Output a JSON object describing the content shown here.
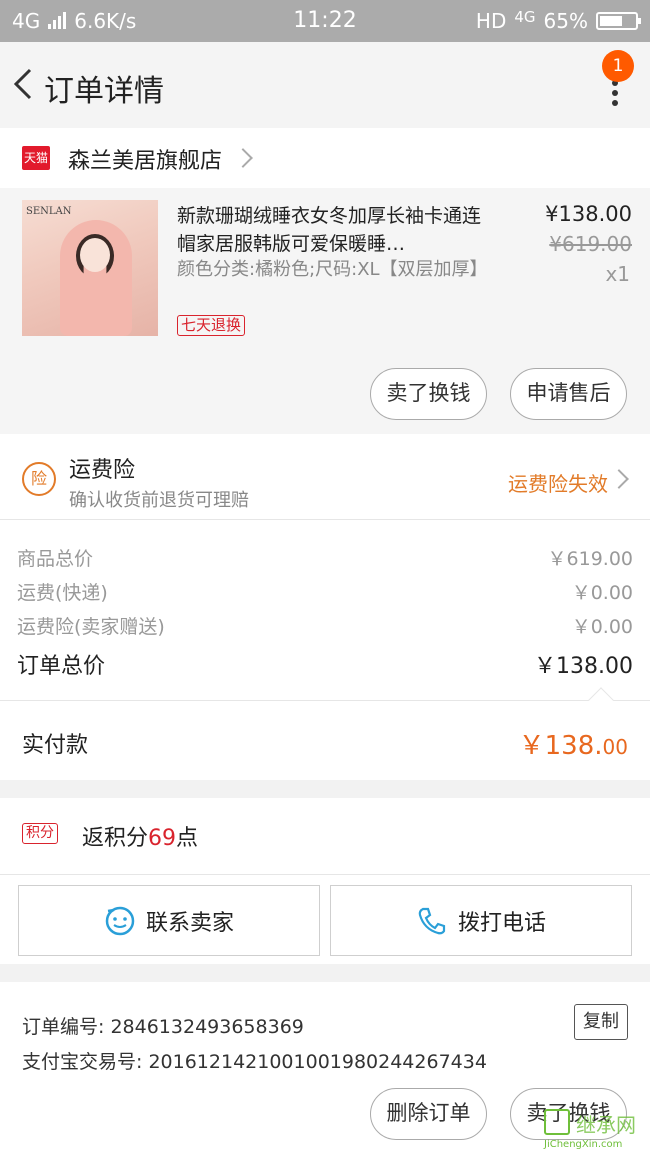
{
  "status_bar": {
    "network": "4G",
    "speed": "6.6K/s",
    "time": "11:22",
    "hd": "HD",
    "network_right": "4G",
    "battery": "65%",
    "battery_level": 0.65
  },
  "nav": {
    "title": "订单详情",
    "badge_count": "1"
  },
  "shop": {
    "icon_label": "天猫",
    "name": "森兰美居旗舰店"
  },
  "product": {
    "image_brand": "SENLAN",
    "title": "新款珊瑚绒睡衣女冬加厚长袖卡通连帽家居服韩版可爱保暖睡…",
    "sku": "颜色分类:橘粉色;尺码:XL【双层加厚】",
    "tag": "七天退换",
    "price": "¥138.00",
    "original_price": "¥619.00",
    "quantity": "x1",
    "btn_sell": "卖了换钱",
    "btn_after_sale": "申请售后"
  },
  "insurance": {
    "icon_label": "险",
    "title": "运费险",
    "subtitle": "确认收货前退货可理赔",
    "status": "运费险失效"
  },
  "prices": {
    "goods_label": "商品总价",
    "goods_value": "￥619.00",
    "shipping_label": "运费(快递)",
    "shipping_value": "￥0.00",
    "ins_label": "运费险(卖家赠送)",
    "ins_value": "￥0.00",
    "total_label": "订单总价",
    "total_value": "￥138.00"
  },
  "paid": {
    "label": "实付款",
    "amount_main": "￥138.",
    "amount_dec": "00"
  },
  "points": {
    "icon_label": "积分",
    "text_prefix": "返积分",
    "number": "69",
    "text_suffix": "点"
  },
  "actions": {
    "contact_seller": "联系卖家",
    "call_phone": "拨打电话"
  },
  "order_info": {
    "order_no_label": "订单编号: ",
    "order_no": "2846132493658369",
    "alipay_label": "支付宝交易号: ",
    "alipay_no": "2016121421001001980244267434",
    "copy_label": "复制",
    "delete_btn": "删除订单",
    "sell_btn": "卖了换钱"
  },
  "watermark": {
    "text": "JiChengXin.com",
    "cn": "继承网"
  },
  "colors": {
    "accent_orange": "#e8681f",
    "tmall_red": "#e21a2c",
    "badge_orange": "#ff5a00"
  }
}
